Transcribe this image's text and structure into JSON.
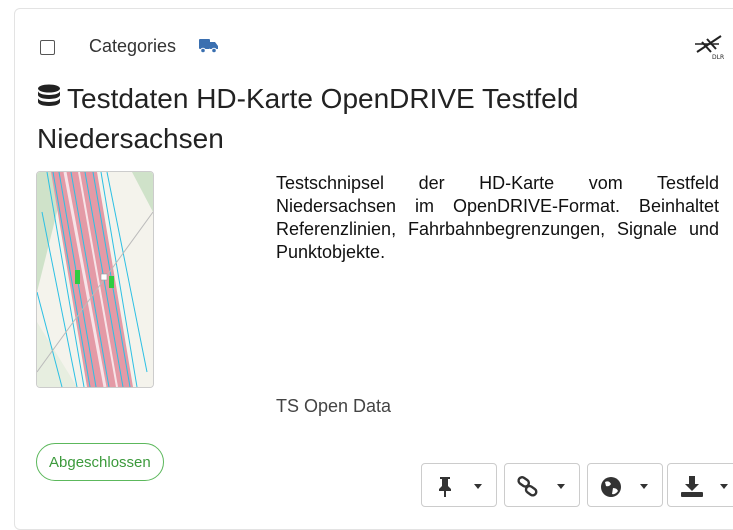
{
  "card": {
    "categories_label": "Categories",
    "title": "Testdaten HD-Karte OpenDRIVE Testfeld Niedersachsen",
    "description": "Testschnipsel der HD-Karte vom Testfeld Niedersachsen im OpenDRIVE-Format. Beinhaltet Referenzlinien, Fahrbahnbegrenzungen, Signale und Punktobjekte.",
    "source": "TS Open Data",
    "status": "Abgeschlossen",
    "icons": {
      "category": "truck-icon",
      "logo": "dlr-logo",
      "dataset": "database-icon",
      "actions": [
        "pin-icon",
        "link-icon",
        "globe-icon",
        "download-icon"
      ]
    },
    "colors": {
      "truck": "#3a6fb0",
      "status": "#5cb85c"
    }
  }
}
